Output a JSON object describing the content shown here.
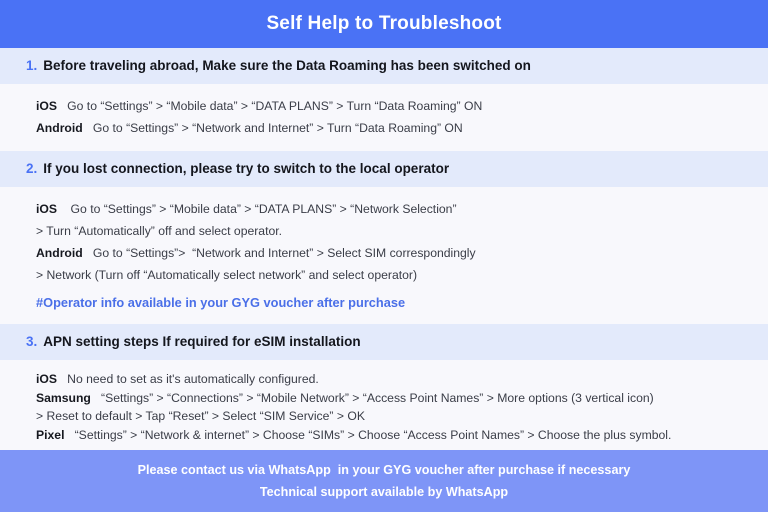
{
  "header": {
    "title": "Self Help to Troubleshoot",
    "background_color": "#4a72f5",
    "text_color": "#ffffff"
  },
  "theme": {
    "accent_blue": "#4a72f5",
    "section_band": "#e3eafb",
    "body_background": "#f8f8fc",
    "footer_background": "#7e95f7",
    "note_color": "#4a6fe8",
    "body_text_color": "#3a3d47"
  },
  "sections": [
    {
      "number": "1.",
      "title_lead": "Before traveling abroad,",
      "title_rest": " Make sure the Data Roaming has been switched on",
      "lines": [
        {
          "platform": "iOS",
          "text": "   Go to “Settings” > “Mobile data” > “DATA PLANS” > Turn “Data Roaming” ON"
        },
        {
          "platform": "Android",
          "text": "   Go to “Settings” > “Network and Internet” > Turn “Data Roaming” ON"
        }
      ],
      "note": ""
    },
    {
      "number": "2.",
      "title_lead": "If you lost connection, please try to switch to the local operator",
      "title_rest": "",
      "lines": [
        {
          "platform": "iOS",
          "text": "    Go to “Settings” > “Mobile data” > “DATA PLANS” > “Network Selection”"
        },
        {
          "platform": "",
          "text": "> Turn “Automatically” off and select operator."
        },
        {
          "platform": "Android",
          "text": "   Go to “Settings”>  “Network and Internet” > Select SIM correspondingly"
        },
        {
          "platform": "",
          "text": "> Network (Turn off “Automatically select network” and select operator)"
        }
      ],
      "note": "#Operator info available in your GYG voucher after purchase"
    },
    {
      "number": "3.",
      "title_lead": "APN setting steps If required for eSIM installation",
      "title_rest": "",
      "lines": [
        {
          "platform": "iOS",
          "text": "   No need to set as it's automatically configured."
        },
        {
          "platform": "Samsung",
          "text": "   “Settings” > “Connections” > “Mobile Network” > “Access Point Names” > More options (3 vertical icon)"
        },
        {
          "platform": "",
          "text": "> Reset to default > Tap “Reset” > Select “SIM Service” > OK"
        },
        {
          "platform": "Pixel",
          "text": "   “Settings” > “Network & internet” > Choose “SIMs” > Choose “Access Point Names” > Choose the plus symbol."
        }
      ],
      "note": ""
    }
  ],
  "footer": {
    "line1": "Please contact us via WhatsApp  in your GYG voucher after purchase if necessary",
    "line2": "Technical support available by WhatsApp"
  }
}
